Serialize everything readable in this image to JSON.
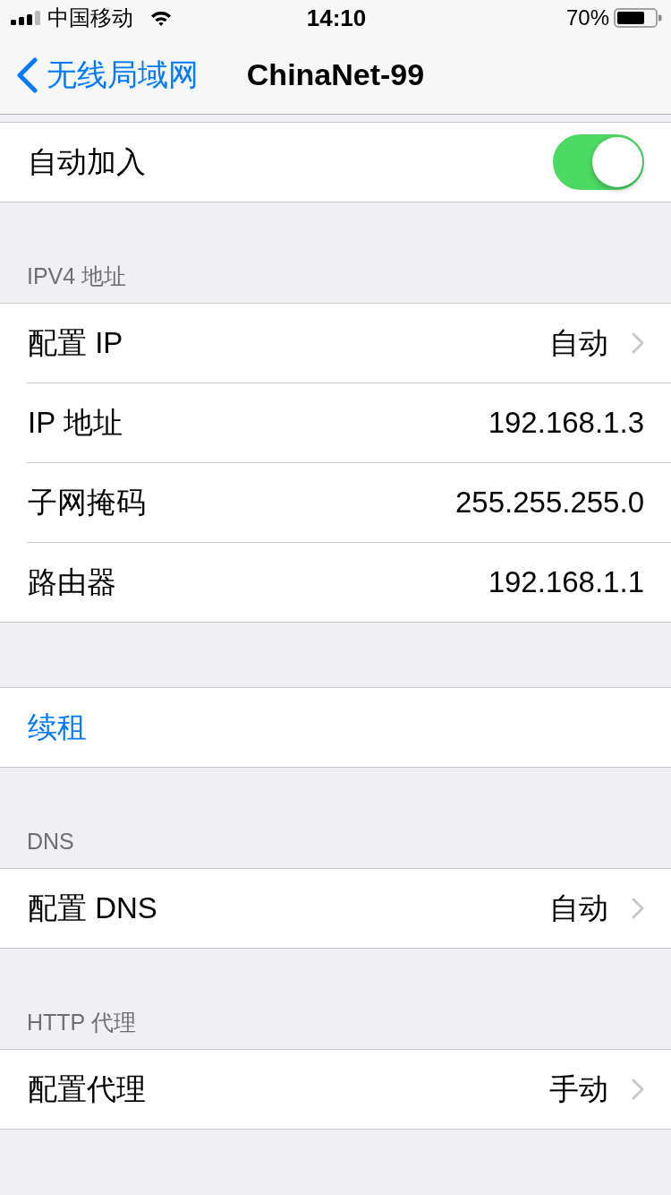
{
  "status_bar": {
    "carrier": "中国移动",
    "time": "14:10",
    "battery": "70%"
  },
  "nav_bar": {
    "back": "无线局域网",
    "title": "ChinaNet-99"
  },
  "sections": [
    {
      "rows": [
        {
          "kind": "toggle",
          "label": "自动加入",
          "on": true
        }
      ]
    },
    {
      "header": "IPV4 地址",
      "rows": [
        {
          "kind": "disclosure",
          "label": "配置 IP",
          "value": "自动"
        },
        {
          "kind": "value",
          "label": "IP 地址",
          "value": "192.168.1.3"
        },
        {
          "kind": "value",
          "label": "子网掩码",
          "value": "255.255.255.0"
        },
        {
          "kind": "value",
          "label": "路由器",
          "value": "192.168.1.1"
        }
      ]
    },
    {
      "rows": [
        {
          "kind": "action",
          "label": "续租"
        }
      ]
    },
    {
      "header": "DNS",
      "rows": [
        {
          "kind": "disclosure",
          "label": "配置 DNS",
          "value": "自动"
        }
      ]
    },
    {
      "header": "HTTP 代理",
      "rows": [
        {
          "kind": "disclosure",
          "label": "配置代理",
          "value": "手动"
        }
      ]
    }
  ]
}
